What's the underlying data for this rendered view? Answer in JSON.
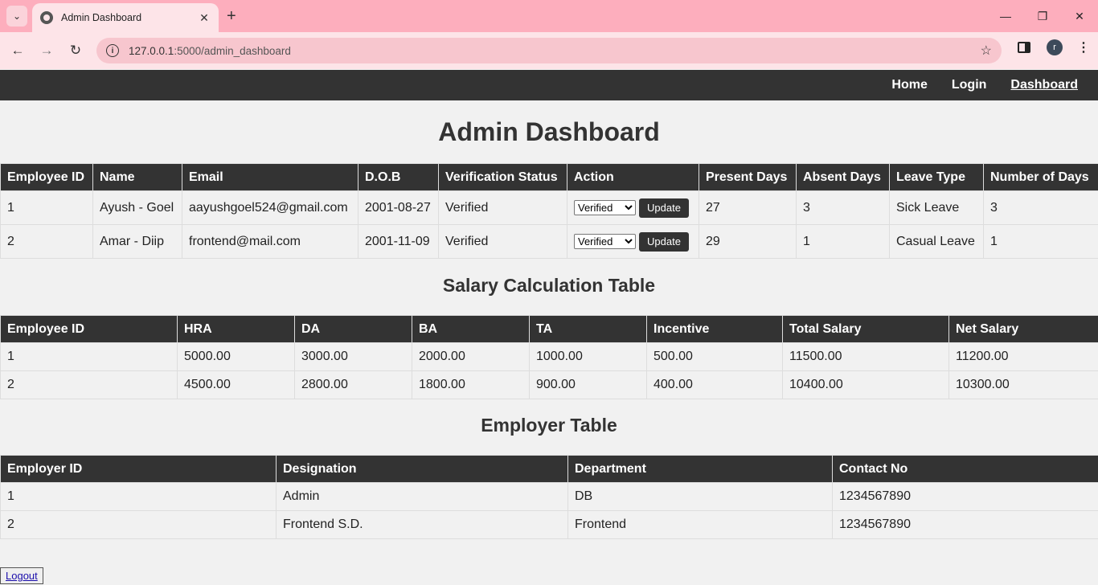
{
  "browser": {
    "tab_title": "Admin Dashboard",
    "url_host": "127.0.0.1",
    "url_rest": ":5000/admin_dashboard",
    "profile_initial": "r"
  },
  "nav": {
    "home": "Home",
    "login": "Login",
    "dashboard": "Dashboard"
  },
  "page_title": "Admin Dashboard",
  "employees": {
    "headers": [
      "Employee ID",
      "Name",
      "Email",
      "D.O.B",
      "Verification Status",
      "Action",
      "Present Days",
      "Absent Days",
      "Leave Type",
      "Number of Days"
    ],
    "rows": [
      {
        "id": "1",
        "name": "Ayush - Goel",
        "email": "aayushgoel524@gmail.com",
        "dob": "2001-08-27",
        "status": "Verified",
        "select": "Verified",
        "button": "Update",
        "present": "27",
        "absent": "3",
        "leave_type": "Sick Leave",
        "days": "3"
      },
      {
        "id": "2",
        "name": "Amar - Diip",
        "email": "frontend@mail.com",
        "dob": "2001-11-09",
        "status": "Verified",
        "select": "Verified",
        "button": "Update",
        "present": "29",
        "absent": "1",
        "leave_type": "Casual Leave",
        "days": "1"
      }
    ]
  },
  "salary": {
    "title": "Salary Calculation Table",
    "headers": [
      "Employee ID",
      "HRA",
      "DA",
      "BA",
      "TA",
      "Incentive",
      "Total Salary",
      "Net Salary"
    ],
    "rows": [
      [
        "1",
        "5000.00",
        "3000.00",
        "2000.00",
        "1000.00",
        "500.00",
        "11500.00",
        "11200.00"
      ],
      [
        "2",
        "4500.00",
        "2800.00",
        "1800.00",
        "900.00",
        "400.00",
        "10400.00",
        "10300.00"
      ]
    ]
  },
  "employer": {
    "title": "Employer Table",
    "headers": [
      "Employer ID",
      "Designation",
      "Department",
      "Contact No"
    ],
    "rows": [
      [
        "1",
        "Admin",
        "DB",
        "1234567890"
      ],
      [
        "2",
        "Frontend S.D.",
        "Frontend",
        "1234567890"
      ]
    ]
  },
  "logout": "Logout"
}
